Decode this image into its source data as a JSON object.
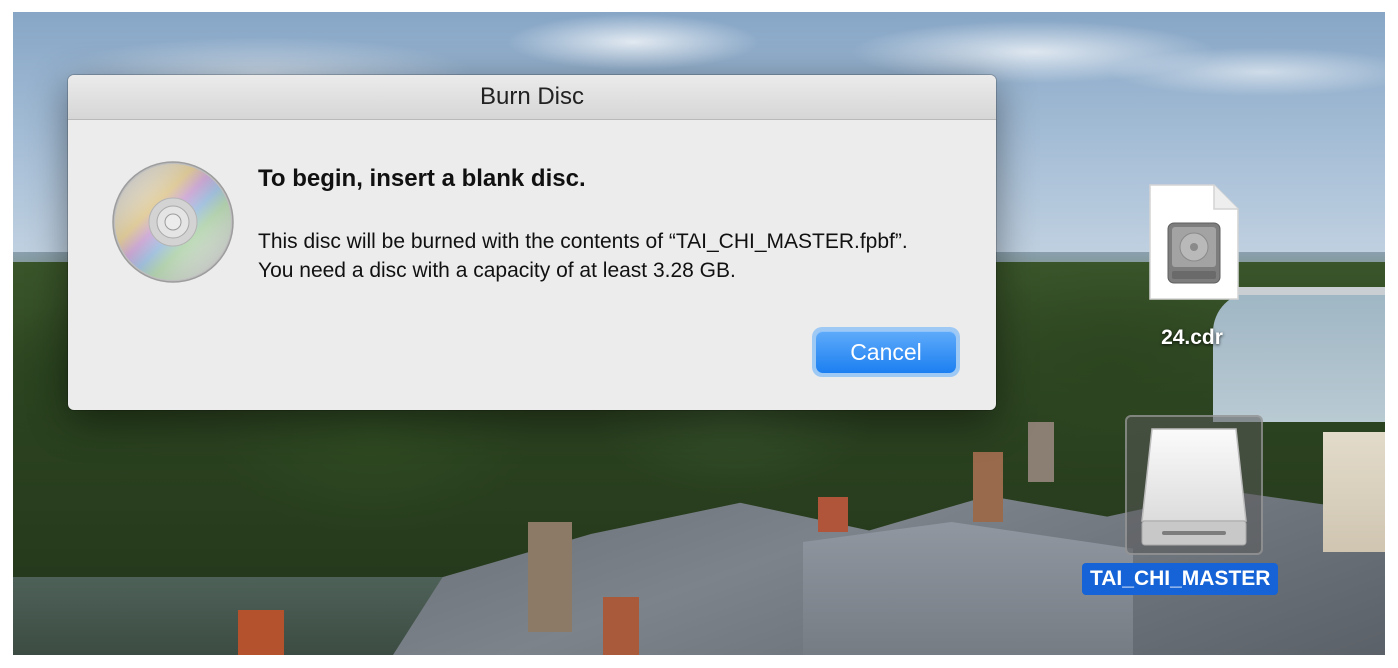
{
  "dialog": {
    "title": "Burn Disc",
    "heading": "To begin, insert a blank disc.",
    "message": "This disc will be burned with the contents of “TAI_CHI_MASTER.fpbf”. You need a disc with a capacity of at least 3.28 GB.",
    "cancel_label": "Cancel",
    "icon": "optical-disc-icon"
  },
  "desktop": {
    "items": [
      {
        "label": "24.cdr",
        "icon": "disk-image-document-icon",
        "selected": false
      },
      {
        "label": "TAI_CHI_MASTER",
        "icon": "external-drive-icon",
        "selected": true
      }
    ]
  },
  "colors": {
    "accent": "#1c7ff1",
    "selection": "#1563d6",
    "dialog_bg": "#ececec"
  }
}
